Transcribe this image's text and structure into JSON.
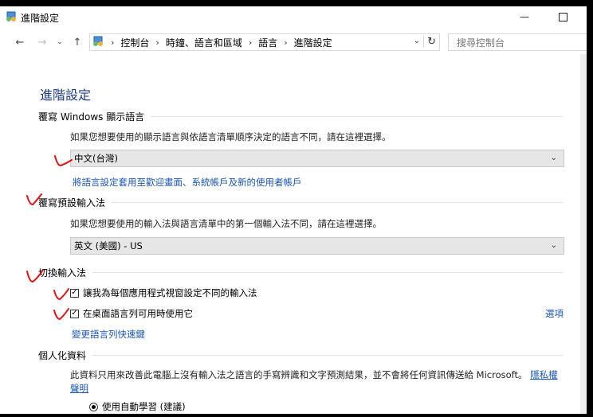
{
  "window": {
    "title": "進階設定",
    "minimize_icon": "minimize-icon",
    "maximize_icon": "maximize-icon"
  },
  "address_bar": {
    "breadcrumbs": [
      "控制台",
      "時鐘、語言和區域",
      "語言",
      "進階設定"
    ],
    "search_placeholder": "搜尋控制台"
  },
  "page": {
    "title": "進階設定",
    "display_language": {
      "heading": "覆寫 Windows 顯示語言",
      "description": "如果您想要使用的顯示語言與依語言清單順序決定的語言不同，請在這裡選擇。",
      "selected": "中文(台灣)",
      "apply_link": "將語言設定套用至歡迎畫面、系統帳戶及新的使用者帳戶"
    },
    "default_input": {
      "heading": "覆寫預設輸入法",
      "description": "如果您想要使用的輸入法與語言清單中的第一個輸入法不同，請在這裡選擇。",
      "selected": "英文 (美國) - US"
    },
    "switch_input": {
      "heading": "切換輸入法",
      "checkbox1_label": "讓我為每個應用程式視窗設定不同的輸入法",
      "checkbox1_checked": true,
      "checkbox2_label": "在桌面語言列可用時使用它",
      "checkbox2_checked": true,
      "options_link": "選項",
      "hotkeys_link": "變更語言列快速鍵"
    },
    "personalization": {
      "heading": "個人化資料",
      "description": "此資料只用來改善此電腦上沒有輸入法之語言的手寫辨識和文字預測結果，並不會將任何資訊傳送給 Microsoft。",
      "privacy_link_part1": "隱私權",
      "privacy_link_part2": "聲明",
      "radio_auto_label": "使用自動學習 (建議)",
      "radio_auto_selected": true
    }
  },
  "annotations": {
    "color": "#e01010"
  }
}
